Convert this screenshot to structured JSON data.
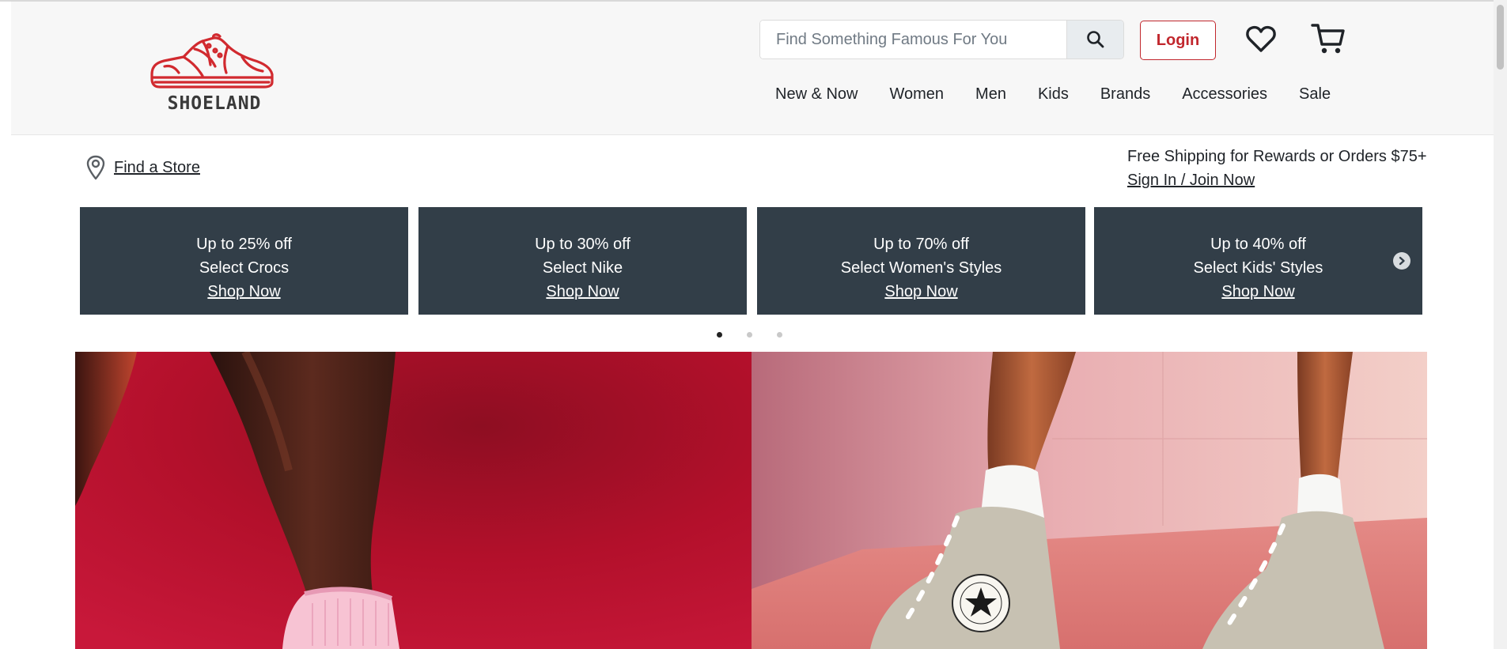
{
  "brand": {
    "name": "SHOELAND",
    "accent": "#c1272d"
  },
  "search": {
    "placeholder": "Find Something Famous For You",
    "icon": "search-icon"
  },
  "header": {
    "login_label": "Login",
    "wishlist_icon": "heart-icon",
    "cart_icon": "cart-icon"
  },
  "nav": {
    "items": [
      {
        "label": "New & Now"
      },
      {
        "label": "Women"
      },
      {
        "label": "Men"
      },
      {
        "label": "Kids"
      },
      {
        "label": "Brands"
      },
      {
        "label": "Accessories"
      },
      {
        "label": "Sale"
      }
    ]
  },
  "utility": {
    "store_label": "Find a Store",
    "store_icon": "location-pin-icon",
    "shipping_text": "Free Shipping for Rewards or Orders $75+",
    "signin_label": "Sign In / Join Now"
  },
  "promos": [
    {
      "line1": "Up to 25% off",
      "line2": "Select Crocs",
      "cta": "Shop Now"
    },
    {
      "line1": "Up to 30% off",
      "line2": "Select Nike",
      "cta": "Shop Now"
    },
    {
      "line1": "Up to 70% off",
      "line2": "Select Women's Styles",
      "cta": "Shop Now"
    },
    {
      "line1": "Up to 40% off",
      "line2": "Select Kids' Styles",
      "cta": "Shop Now"
    }
  ],
  "carousel": {
    "pages": 3,
    "active_page": 1,
    "promo_bg": "#323e48"
  },
  "hero": {
    "left_bg": "#b3102b",
    "right_bg": "#e8a0a2",
    "right_badge": {
      "top": "CONVERSE",
      "bottom": "ALL STAR"
    }
  }
}
